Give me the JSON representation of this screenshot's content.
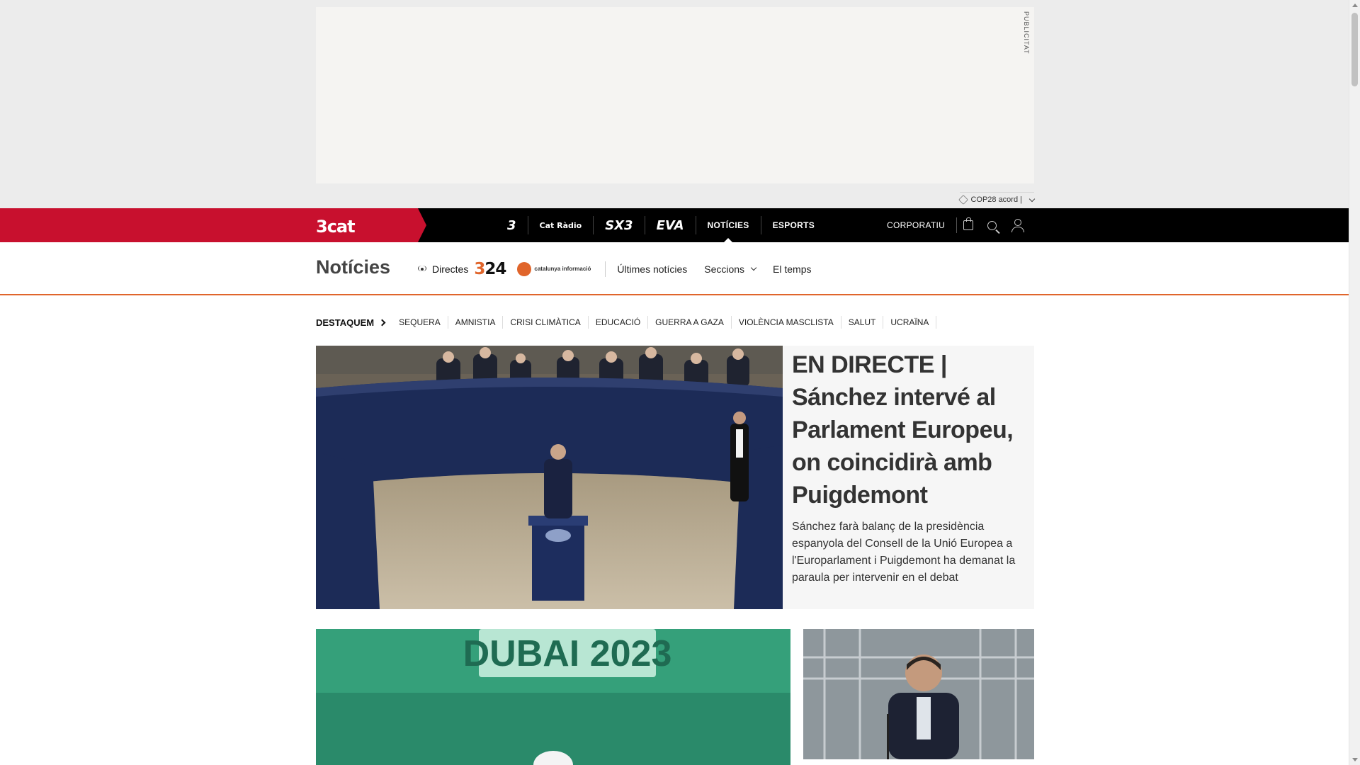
{
  "ad": {
    "label": "PUBLICITAT",
    "tag": "COP28 acord |"
  },
  "topbar": {
    "brand": "3cat",
    "channels": [
      "3",
      "Cat Ràdio",
      "SX3",
      "EVA"
    ],
    "nav": [
      "NOTÍCIES",
      "ESPORTS"
    ],
    "corporate": "CORPORATIU",
    "icons": [
      "shopping-bag-icon",
      "search-icon",
      "user-icon"
    ]
  },
  "secnav": {
    "title": "Notícies",
    "live": "Directes",
    "logo_324_a": "3",
    "logo_324_b": "24",
    "logo_catinfo": "catalunya informació",
    "links": [
      "Últimes notícies",
      "Seccions",
      "El temps"
    ]
  },
  "highlights": {
    "title": "DESTAQUEM",
    "items": [
      "SEQUERA",
      "AMNISTIA",
      "CRISI CLIMÀTICA",
      "EDUCACIÓ",
      "GUERRA A GAZA",
      "VIOLÈNCIA MASCLISTA",
      "SALUT",
      "UCRAÏNA"
    ]
  },
  "hero": {
    "title": "EN DIRECTE | Sánchez intervé al Parlament Europeu, on coincidirà amb Puigdemont",
    "subtitle": "Sánchez farà balanç de la presidència espanyola del Consell de la Unió Europea a l'Europarlament i Puigdemont ha demanat la paraula per intervenir en el debat"
  },
  "cards": {
    "left_banner": "DUBAI 2023"
  }
}
